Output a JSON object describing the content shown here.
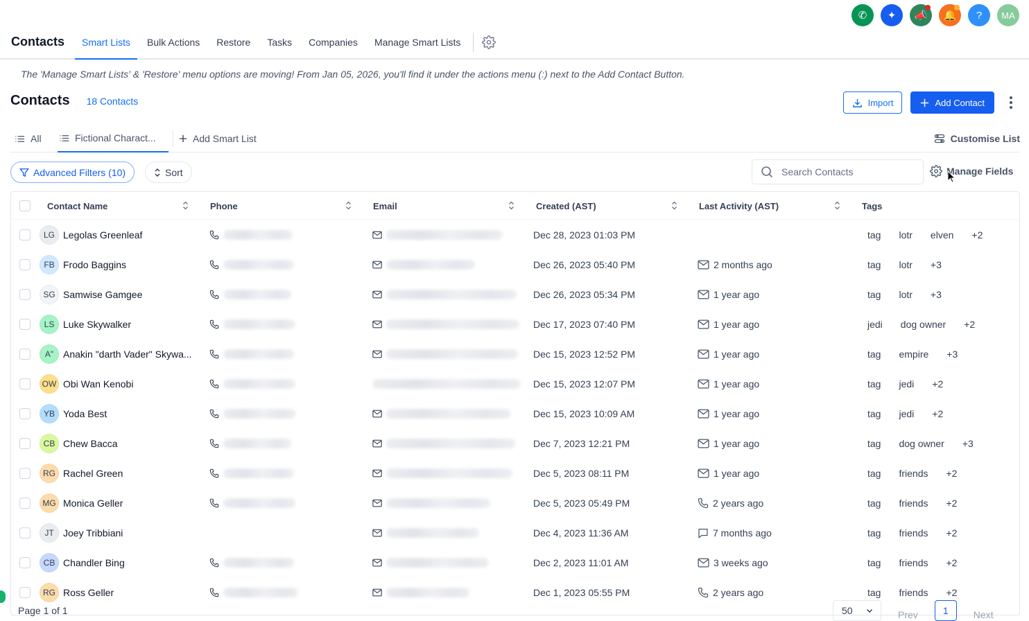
{
  "top_icons": [
    {
      "name": "phone-icon",
      "glyph": "✆",
      "color": "#079455",
      "dot": ""
    },
    {
      "name": "sparkle-icon",
      "glyph": "✦",
      "color": "#155eef",
      "dot": ""
    },
    {
      "name": "megaphone-icon",
      "glyph": "📣",
      "color": "#2f855a",
      "dot": "#d92d20"
    },
    {
      "name": "bell-icon",
      "glyph": "🔔",
      "color": "#f7701e",
      "dot": "#fdb022"
    },
    {
      "name": "help-icon",
      "glyph": "?",
      "color": "#2e90fa",
      "dot": ""
    },
    {
      "name": "user-avatar",
      "glyph": "MA",
      "color": "#86cb9c",
      "dot": ""
    }
  ],
  "nav": {
    "title": "Contacts",
    "tabs": [
      "Smart Lists",
      "Bulk Actions",
      "Restore",
      "Tasks",
      "Companies",
      "Manage Smart Lists"
    ],
    "active_tab": "Smart Lists"
  },
  "banner": "The 'Manage Smart Lists' & 'Restore' menu options are moving! From Jan 05, 2026, you'll find it under the actions menu (:) next to the Add Contact Button.",
  "page": {
    "title": "Contacts",
    "count": "18 Contacts",
    "import_label": "Import",
    "add_label": "Add Contact"
  },
  "list_tabs": {
    "all": "All",
    "active": "Fictional Charact...",
    "add": "Add Smart List",
    "customise": "Customise List"
  },
  "filters": {
    "advanced": "Advanced Filters (10)",
    "sort": "Sort",
    "search_placeholder": "Search Contacts",
    "manage_fields": "Manage Fields"
  },
  "columns": [
    "Contact Name",
    "Phone",
    "Email",
    "Created (AST)",
    "Last Activity (AST)",
    "Tags"
  ],
  "rows": [
    {
      "initials": "LG",
      "avatar_color": "#eaecf0",
      "name": "Legolas Greenleaf",
      "phone": true,
      "created": "Dec 28, 2023 01:03 PM",
      "activity_icon": "",
      "activity": "",
      "tags": [
        "tag",
        "lotr",
        "elven",
        "+2"
      ]
    },
    {
      "initials": "FB",
      "avatar_color": "#d1e9ff",
      "name": "Frodo Baggins",
      "phone": true,
      "created": "Dec 26, 2023 05:40 PM",
      "activity_icon": "mail",
      "activity": "2 months ago",
      "tags": [
        "tag",
        "lotr",
        "+3"
      ]
    },
    {
      "initials": "SG",
      "avatar_color": "#f2f4f7",
      "name": "Samwise Gamgee",
      "phone": true,
      "created": "Dec 26, 2023 05:34 PM",
      "activity_icon": "mail",
      "activity": "1 year ago",
      "tags": [
        "tag",
        "lotr",
        "+3"
      ]
    },
    {
      "initials": "LS",
      "avatar_color": "#a6f4c5",
      "name": "Luke Skywalker",
      "phone": true,
      "created": "Dec 17, 2023 07:40 PM",
      "activity_icon": "mail",
      "activity": "1 year ago",
      "tags": [
        "jedi",
        "dog owner",
        "+2"
      ]
    },
    {
      "initials": "A\"",
      "avatar_color": "#a6f4c5",
      "name": "Anakin \"darth Vader\" Skywa...",
      "phone": true,
      "created": "Dec 15, 2023 12:52 PM",
      "activity_icon": "mail",
      "activity": "1 year ago",
      "tags": [
        "tag",
        "empire",
        "+3"
      ]
    },
    {
      "initials": "OW",
      "avatar_color": "#fedf89",
      "name": "Obi Wan Kenobi",
      "phone": true,
      "created": "Dec 15, 2023 12:07 PM",
      "activity_icon": "mail",
      "activity": "1 year ago",
      "tags": [
        "tag",
        "jedi",
        "+2"
      ]
    },
    {
      "initials": "YB",
      "avatar_color": "#b2ddff",
      "name": "Yoda Best",
      "phone": true,
      "created": "Dec 15, 2023 10:09 AM",
      "activity_icon": "mail",
      "activity": "1 year ago",
      "tags": [
        "tag",
        "jedi",
        "+2"
      ]
    },
    {
      "initials": "CB",
      "avatar_color": "#d9f99d",
      "name": "Chew Bacca",
      "phone": true,
      "created": "Dec 7, 2023 12:21 PM",
      "activity_icon": "mail",
      "activity": "1 year ago",
      "tags": [
        "tag",
        "dog owner",
        "+3"
      ]
    },
    {
      "initials": "RG",
      "avatar_color": "#fddcab",
      "name": "Rachel Green",
      "phone": true,
      "created": "Dec 5, 2023 08:11 PM",
      "activity_icon": "mail",
      "activity": "1 year ago",
      "tags": [
        "tag",
        "friends",
        "+2"
      ]
    },
    {
      "initials": "MG",
      "avatar_color": "#fddcab",
      "name": "Monica Geller",
      "phone": true,
      "created": "Dec 5, 2023 05:49 PM",
      "activity_icon": "phone",
      "activity": "2 years ago",
      "tags": [
        "tag",
        "friends",
        "+2"
      ]
    },
    {
      "initials": "JT",
      "avatar_color": "#eaecf0",
      "name": "Joey Tribbiani",
      "phone": false,
      "created": "Dec 4, 2023 11:36 AM",
      "activity_icon": "chat",
      "activity": "7 months ago",
      "tags": [
        "tag",
        "friends",
        "+2"
      ]
    },
    {
      "initials": "CB",
      "avatar_color": "#c7d7fe",
      "name": "Chandler Bing",
      "phone": true,
      "created": "Dec 2, 2023 11:01 AM",
      "activity_icon": "mail",
      "activity": "3 weeks ago",
      "tags": [
        "tag",
        "friends",
        "+2"
      ]
    },
    {
      "initials": "RG",
      "avatar_color": "#fddcab",
      "name": "Ross Geller",
      "phone": true,
      "created": "Dec 1, 2023 05:55 PM",
      "activity_icon": "phone",
      "activity": "2 years ago",
      "tags": [
        "tag",
        "friends",
        "+2"
      ]
    }
  ],
  "footer": {
    "page_of": "Page 1 of 1",
    "per_page": "50",
    "prev": "Prev",
    "current": "1",
    "next": "Next"
  }
}
